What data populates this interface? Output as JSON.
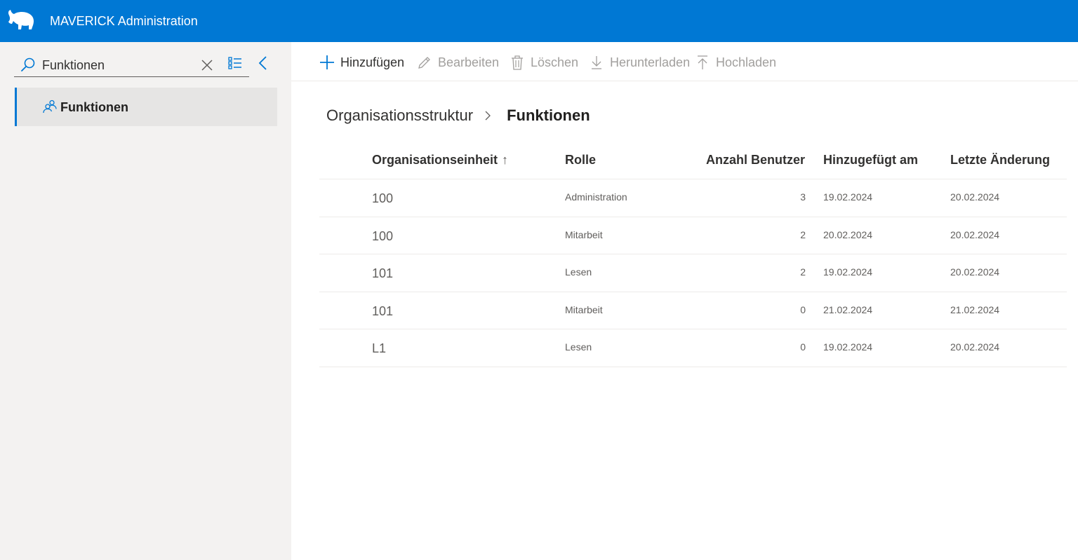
{
  "header": {
    "app_title": "MAVERICK Administration",
    "brand_color": "#0078d4",
    "logo_icon": "bull-logo-icon"
  },
  "sidebar": {
    "search": {
      "value": "Funktionen",
      "placeholder": ""
    },
    "items": [
      {
        "label": "Funktionen",
        "icon": "people-icon",
        "selected": true
      }
    ]
  },
  "toolbar": {
    "add_label": "Hinzufügen",
    "edit_label": "Bearbeiten",
    "delete_label": "Löschen",
    "download_label": "Herunterladen",
    "upload_label": "Hochladen"
  },
  "breadcrumb": {
    "parent": "Organisationsstruktur",
    "current": "Funktionen"
  },
  "table": {
    "columns": {
      "unit": "Organisationseinheit",
      "role": "Rolle",
      "count": "Anzahl Benutzer",
      "added": "Hinzugefügt am",
      "changed": "Letzte Änderung"
    },
    "sort_indicator": "↑",
    "rows": [
      {
        "unit": "100",
        "role": "Administration",
        "count": "3",
        "added": "19.02.2024",
        "changed": "20.02.2024"
      },
      {
        "unit": "100",
        "role": "Mitarbeit",
        "count": "2",
        "added": "20.02.2024",
        "changed": "20.02.2024"
      },
      {
        "unit": "101",
        "role": "Lesen",
        "count": "2",
        "added": "19.02.2024",
        "changed": "20.02.2024"
      },
      {
        "unit": "101",
        "role": "Mitarbeit",
        "count": "0",
        "added": "21.02.2024",
        "changed": "21.02.2024"
      },
      {
        "unit": "L1",
        "role": "Lesen",
        "count": "0",
        "added": "19.02.2024",
        "changed": "20.02.2024"
      }
    ]
  }
}
